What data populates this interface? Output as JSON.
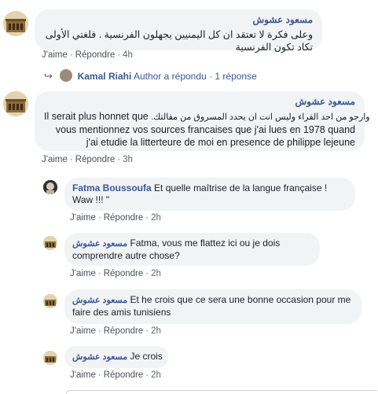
{
  "comments": [
    {
      "author": "مسعود عشوش",
      "text": "وعلى فكرة لا تعتقد ان كل اليمنيين يجهلون الفرنسية . فلغتي الأولى تكاد تكون الفرنسية",
      "like": "J'aime",
      "reply": "Répondre",
      "time": "4h"
    },
    {
      "author": "مسعود عشوش",
      "text_rtl": "وارجو من احد القراء وليس انت ان يحدد المسروق من مقالتك.",
      "text_main": "Il serait plus honnet que",
      "text_line2": "vous mentionnez vos sources francaises que j'ai lues en 1978 quand",
      "text_line3": "j'ai etudie la litterteure de moi en presence de philippe lejeune",
      "like": "J'aime",
      "reply": "Répondre",
      "time": "3h"
    },
    {
      "author": "Fatma Boussoufa",
      "text": "Et quelle maîtrise de la langue française ! Waw !!! \"",
      "like": "J'aime",
      "reply": "Répondre",
      "time": "2h"
    },
    {
      "author": "مسعود عشوش",
      "text": "Fatma, vous me flattez ici ou je dois comprendre autre chose?",
      "like": "J'aime",
      "reply": "Répondre",
      "time": "2h"
    },
    {
      "author": "مسعود عشوش",
      "text": "Et he crois que ce sera une bonne occasion pour me faire des amis tunisiens",
      "like": "J'aime",
      "reply": "Répondre",
      "time": "2h"
    },
    {
      "author": "مسعود عشوش",
      "text": "Je crois",
      "like": "J'aime",
      "reply": "Répondre",
      "time": "2h"
    }
  ],
  "reply_summary": {
    "name": "Kamal Riahi",
    "label": "Author a répondu",
    "count": "1 réponse"
  },
  "separator": "·",
  "colors": {
    "link": "#385898",
    "bubble": "#f2f3f5",
    "meta": "#606770"
  }
}
